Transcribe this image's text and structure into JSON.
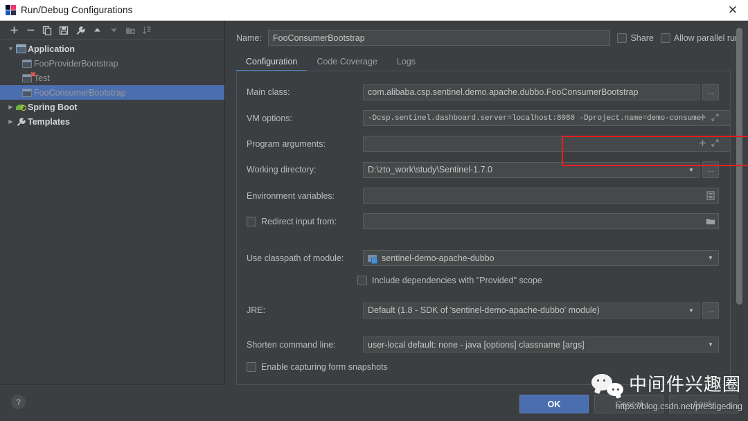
{
  "window": {
    "title": "Run/Debug Configurations",
    "app_icon": "intellij-idea-icon",
    "close_label": "✕"
  },
  "left_panel": {
    "toolbar": [
      {
        "name": "add-configuration-button",
        "icon": "plus-icon",
        "glyph": "+",
        "enabled": true
      },
      {
        "name": "remove-configuration-button",
        "icon": "minus-icon",
        "glyph": "−",
        "enabled": true
      },
      {
        "name": "copy-configuration-button",
        "icon": "copy-icon",
        "glyph": "⧉",
        "enabled": true
      },
      {
        "name": "save-configuration-button",
        "icon": "save-icon",
        "glyph": "Ὃe",
        "enabled": true
      },
      {
        "name": "edit-templates-button",
        "icon": "wrench-icon",
        "glyph": "ὒ7",
        "enabled": true
      },
      {
        "name": "move-up-button",
        "icon": "arrow-up-icon",
        "glyph": "▲",
        "enabled": true
      },
      {
        "name": "move-down-button",
        "icon": "arrow-down-icon",
        "glyph": "▼",
        "enabled": false
      },
      {
        "name": "create-folder-button",
        "icon": "folder-add-icon",
        "glyph": "Ὄ1",
        "enabled": false
      },
      {
        "name": "sort-configurations-button",
        "icon": "sort-az-icon",
        "glyph": "↧",
        "enabled": false
      }
    ],
    "tree": [
      {
        "label": "Application",
        "level": 0,
        "expanded": true,
        "icon": "application-icon",
        "selected": false
      },
      {
        "label": "FooProviderBootstrap",
        "level": 1,
        "icon": "application-icon",
        "selected": false
      },
      {
        "label": "Test",
        "level": 1,
        "icon": "application-error-icon",
        "selected": false
      },
      {
        "label": "FooConsumerBootstrap",
        "level": 1,
        "icon": "application-icon",
        "selected": true
      },
      {
        "label": "Spring Boot",
        "level": 0,
        "expanded": false,
        "icon": "spring-boot-icon",
        "selected": false
      },
      {
        "label": "Templates",
        "level": 0,
        "expanded": false,
        "icon": "wrench-icon",
        "selected": false
      }
    ]
  },
  "right_panel": {
    "name_label": "Name:",
    "name_value": "FooConsumerBootstrap",
    "share_label": "Share",
    "share_checked": false,
    "allow_parallel_label": "Allow parallel run",
    "allow_parallel_checked": false,
    "tabs": [
      {
        "label": "Configuration",
        "active": true
      },
      {
        "label": "Code Coverage",
        "active": false
      },
      {
        "label": "Logs",
        "active": false
      }
    ],
    "fields": {
      "main_class_label": "Main class:",
      "main_class_value": "com.alibaba.csp.sentinel.demo.apache.dubbo.FooConsumerBootstrap",
      "vm_options_label": "VM options:",
      "vm_options_value": "-Dcsp.sentinel.dashboard.server=localhost:8080  -Dproject.name=demo-consumer",
      "program_arguments_label": "Program arguments:",
      "program_arguments_value": "",
      "working_directory_label": "Working directory:",
      "working_directory_value": "D:\\zto_work\\study\\Sentinel-1.7.0",
      "environment_variables_label": "Environment variables:",
      "environment_variables_value": "",
      "redirect_input_label": "Redirect input from:",
      "redirect_input_checked": false,
      "redirect_input_value": "",
      "use_classpath_label": "Use classpath of module:",
      "use_classpath_value": "sentinel-demo-apache-dubbo",
      "include_provided_label": "Include dependencies with \"Provided\" scope",
      "include_provided_checked": false,
      "jre_label": "JRE:",
      "jre_value": "Default (1.8 - SDK of 'sentinel-demo-apache-dubbo' module)",
      "shorten_cmd_label": "Shorten command line:",
      "shorten_cmd_value": "user-local default: none - java [options] classname [args]",
      "enable_snapshots_label": "Enable capturing form snapshots",
      "enable_snapshots_checked": false
    },
    "browse_button_label": "...",
    "annotation": {
      "highlight_color": "#ff1d1d",
      "highlight_target": "vm-options-field"
    }
  },
  "footer": {
    "help_label": "?",
    "ok_label": "OK",
    "cancel_label": "Cancel",
    "apply_label": "Apply",
    "ok_color": "#4b6eaf"
  },
  "watermark": {
    "logo": "wechat-icon",
    "text": "中间件兴趣圈",
    "url": "https://blog.csdn.net/prestigeding"
  }
}
